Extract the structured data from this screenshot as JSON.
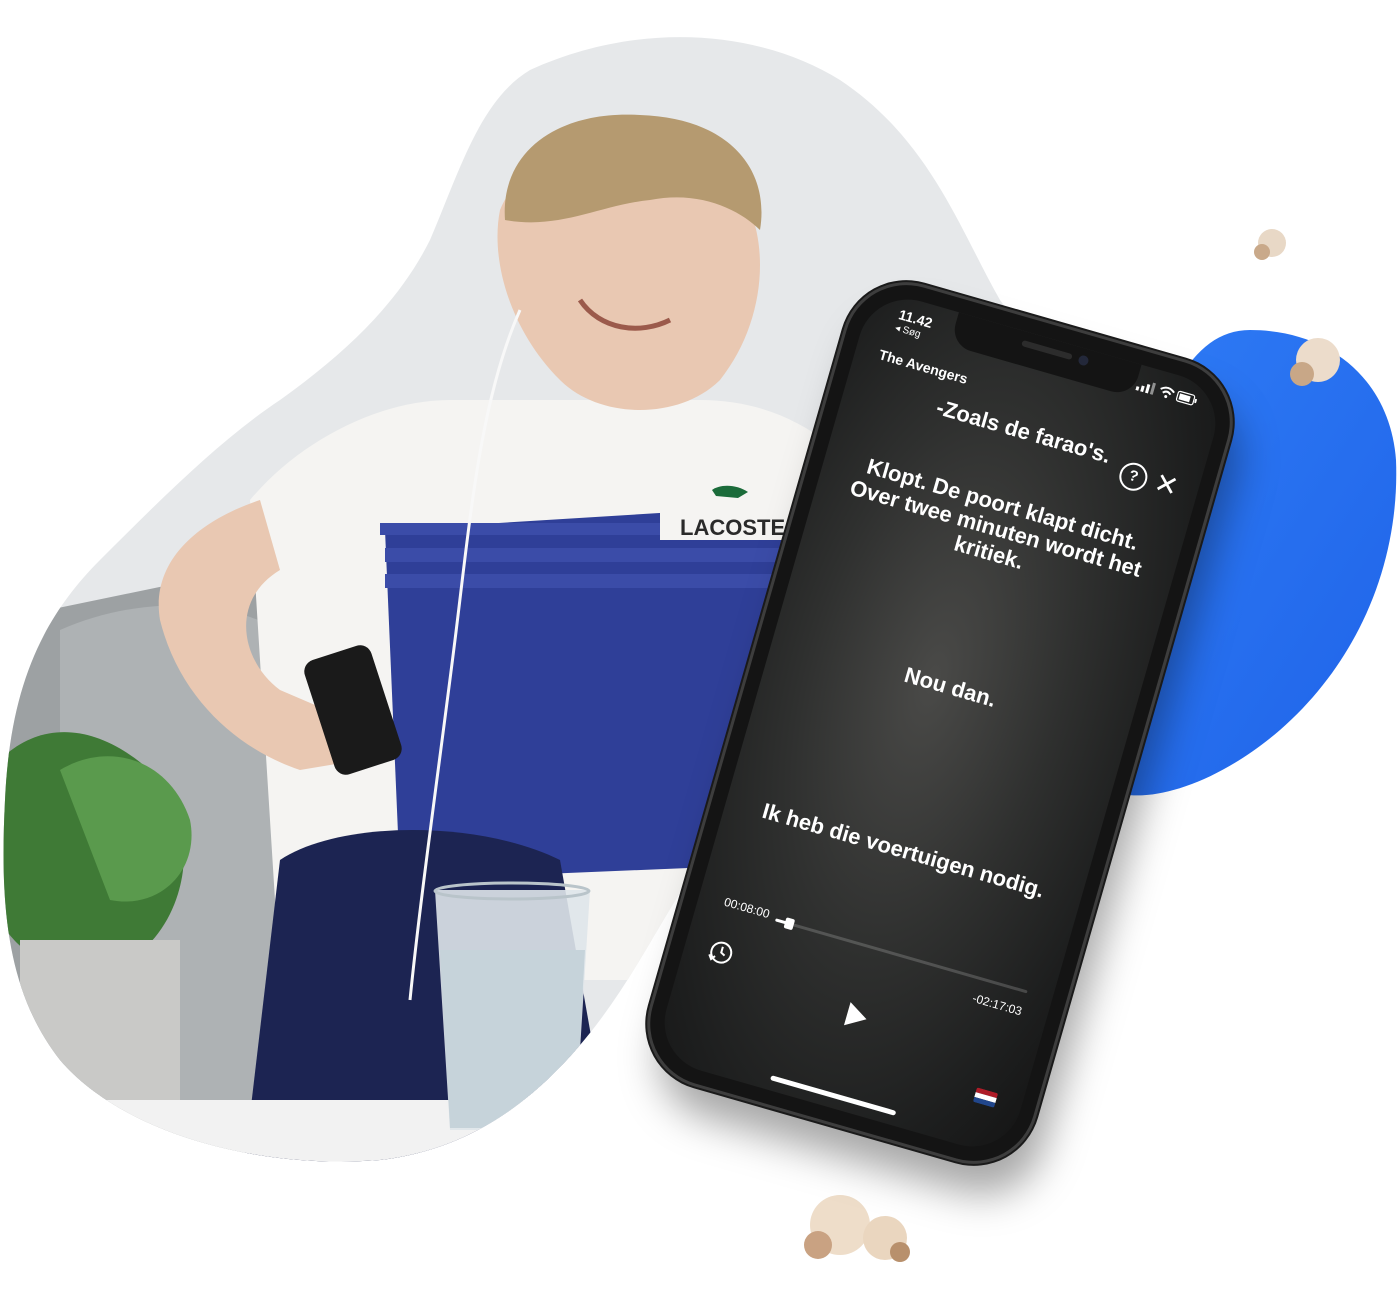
{
  "status_bar": {
    "time": "11.42",
    "back_label": "◂ Søg"
  },
  "player": {
    "title": "The Avengers",
    "help_symbol": "?",
    "close_symbol": "✕",
    "subtitles": [
      "-Zoals de farao's.",
      "Klopt. De poort klapt dicht. Over twee minuten wordt het kritiek.",
      "Nou dan.",
      "Ik heb die voertuigen nodig."
    ],
    "elapsed": "00:08:00",
    "remaining": "-02:17:03",
    "progress_fraction": 0.055,
    "language_flag": "nl-flag-icon"
  },
  "colors": {
    "blob_blue": "#2670f0",
    "flag_red": "#ae1c28",
    "flag_white": "#ffffff",
    "flag_blue": "#21468b"
  }
}
